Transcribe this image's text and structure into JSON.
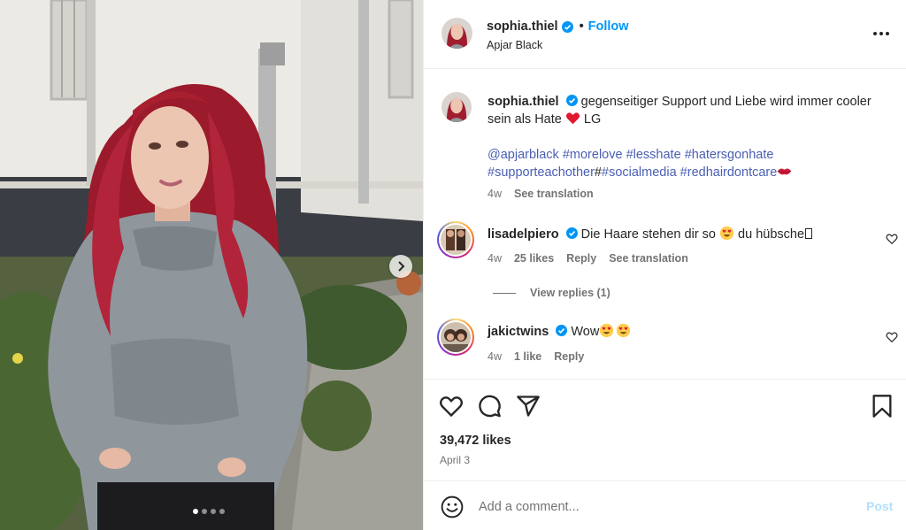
{
  "post": {
    "author": "sophia.thiel",
    "location": "Apjar Black",
    "follow_label": "Follow",
    "separator": "•",
    "carousel": {
      "slide_count": 4,
      "active_index": 0
    }
  },
  "caption": {
    "username": "sophia.thiel",
    "text": "gegenseitiger Support und Liebe wird immer cooler sein als Hate",
    "sign_off": "LG",
    "tags_line1": [
      "@apjarblack",
      "#morelove",
      "#lesshate",
      "#hatersgonhate"
    ],
    "tags_line2_prefix": "#supporteachother",
    "tags_line2_hash": "#",
    "tags_line2": [
      "#socialmedia",
      "#redhairdontcare"
    ],
    "time": "4w",
    "see_translation": "See translation"
  },
  "comments": [
    {
      "username": "lisadelpiero",
      "text": "Die Haare stehen dir so",
      "text_after": "du hübsche",
      "time": "4w",
      "likes": "25 likes",
      "reply": "Reply",
      "see_translation": "See translation",
      "view_replies": "View replies (1)"
    },
    {
      "username": "jakictwins",
      "text": "Wow",
      "time": "4w",
      "likes": "1 like",
      "reply": "Reply"
    }
  ],
  "stats": {
    "likes": "39,472 likes",
    "date": "April 3"
  },
  "add_comment": {
    "placeholder": "Add a comment...",
    "post_label": "Post"
  },
  "colors": {
    "link_blue": "#0095f6",
    "hashtag": "#4a5fb4",
    "muted": "#737373",
    "heart_red": "#ed4956"
  },
  "icons": [
    "verified-badge-icon",
    "more-options-icon",
    "heart-icon",
    "comment-icon",
    "share-icon",
    "bookmark-icon",
    "emoji-icon",
    "chevron-right-icon"
  ]
}
